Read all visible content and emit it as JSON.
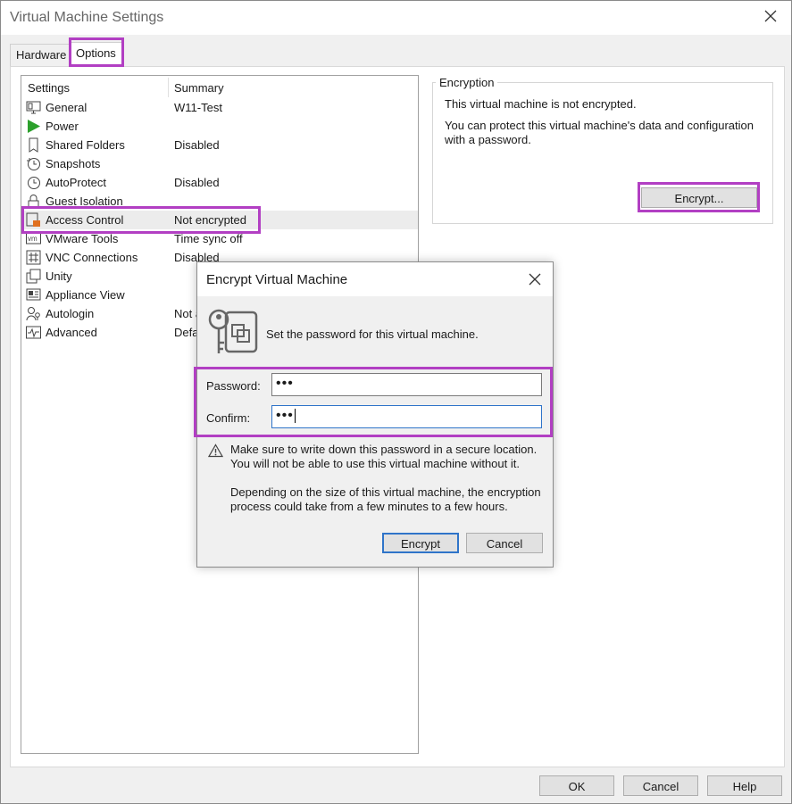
{
  "window": {
    "title": "Virtual Machine Settings"
  },
  "tabs": [
    {
      "label": "Hardware"
    },
    {
      "label": "Options"
    }
  ],
  "list": {
    "header_settings": "Settings",
    "header_summary": "Summary",
    "rows": [
      {
        "label": "General",
        "summary": "W11-Test",
        "icon": "monitor-icon"
      },
      {
        "label": "Power",
        "summary": "",
        "icon": "play-icon"
      },
      {
        "label": "Shared Folders",
        "summary": "Disabled",
        "icon": "folder-icon"
      },
      {
        "label": "Snapshots",
        "summary": "",
        "icon": "snapshot-clock-icon"
      },
      {
        "label": "AutoProtect",
        "summary": "Disabled",
        "icon": "clock-icon"
      },
      {
        "label": "Guest Isolation",
        "summary": "",
        "icon": "lock-icon"
      },
      {
        "label": "Access Control",
        "summary": "Not encrypted",
        "icon": "access-control-icon"
      },
      {
        "label": "VMware Tools",
        "summary": "Time sync off",
        "icon": "vm-icon"
      },
      {
        "label": "VNC Connections",
        "summary": "Disabled",
        "icon": "vnc-icon"
      },
      {
        "label": "Unity",
        "summary": "",
        "icon": "unity-icon"
      },
      {
        "label": "Appliance View",
        "summary": "",
        "icon": "appliance-icon"
      },
      {
        "label": "Autologin",
        "summary": "Not a",
        "icon": "user-key-icon"
      },
      {
        "label": "Advanced",
        "summary": "Defa",
        "icon": "pulse-icon"
      }
    ]
  },
  "encryption": {
    "group_label": "Encryption",
    "status": "This virtual machine is not encrypted.",
    "description_line1": "You can protect this virtual machine's data and configuration",
    "description_line2": "with a password.",
    "encrypt_button": "Encrypt..."
  },
  "dialog": {
    "title": "Encrypt Virtual Machine",
    "instruction": "Set the password for this virtual machine.",
    "password_label": "Password:",
    "password_value": "•••",
    "confirm_label": "Confirm:",
    "confirm_value": "•••",
    "warning_line1": "Make sure to write down this password in a secure location.",
    "warning_line2": "You will not be able to use this virtual machine without it.",
    "info_line1": "Depending on the size of this virtual machine, the encryption",
    "info_line2": "process could take from a few minutes to a few hours.",
    "encrypt_button": "Encrypt",
    "cancel_button": "Cancel"
  },
  "footer": {
    "ok": "OK",
    "cancel": "Cancel",
    "help": "Help"
  },
  "colors": {
    "highlight": "#b23fc3",
    "focus": "#2f74c9",
    "power_green": "#2ca02c"
  }
}
